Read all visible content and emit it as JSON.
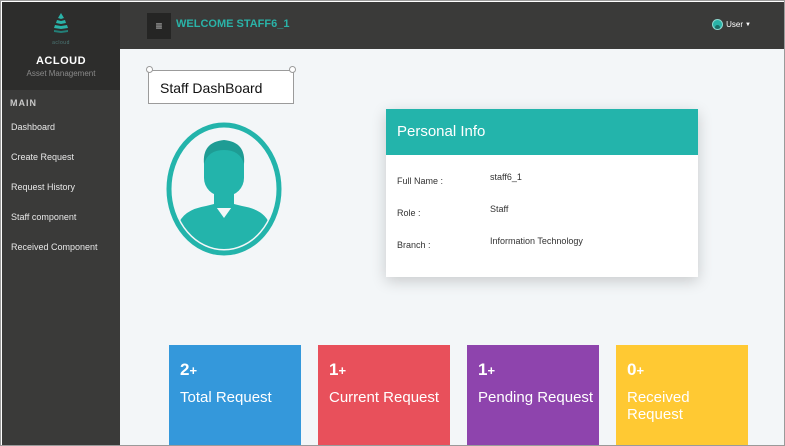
{
  "brand": {
    "logo_sub": "acloud",
    "name": "ACLOUD",
    "tagline": "Asset Management"
  },
  "sidebar": {
    "section_label": "MAIN",
    "items": [
      {
        "label": "Dashboard"
      },
      {
        "label": "Create Request"
      },
      {
        "label": "Request History"
      },
      {
        "label": "Staff component"
      },
      {
        "label": "Received Component"
      }
    ]
  },
  "header": {
    "welcome": "WELCOME STAFF6_1",
    "user_label": "User",
    "menu_icon": "hamburger-icon"
  },
  "page": {
    "title": "Staff DashBoard"
  },
  "personal_info": {
    "heading": "Personal Info",
    "rows": [
      {
        "label": "Full Name :",
        "value": "staff6_1"
      },
      {
        "label": "Role :",
        "value": "Staff"
      },
      {
        "label": "Branch :",
        "value": "Information Technology"
      }
    ]
  },
  "stats": [
    {
      "count": "2",
      "suffix": "+",
      "label": "Total Request",
      "color": "#3498db"
    },
    {
      "count": "1",
      "suffix": "+",
      "label": "Current Request",
      "color": "#e8505b"
    },
    {
      "count": "1",
      "suffix": "+",
      "label": "Pending Request",
      "color": "#8e44ad"
    },
    {
      "count": "0",
      "suffix": "+",
      "label": "Received Request",
      "color": "#ffc933"
    }
  ],
  "colors": {
    "accent": "#23b4ab",
    "sidebar": "#3a3a39",
    "content_bg": "#f3f6f8"
  }
}
